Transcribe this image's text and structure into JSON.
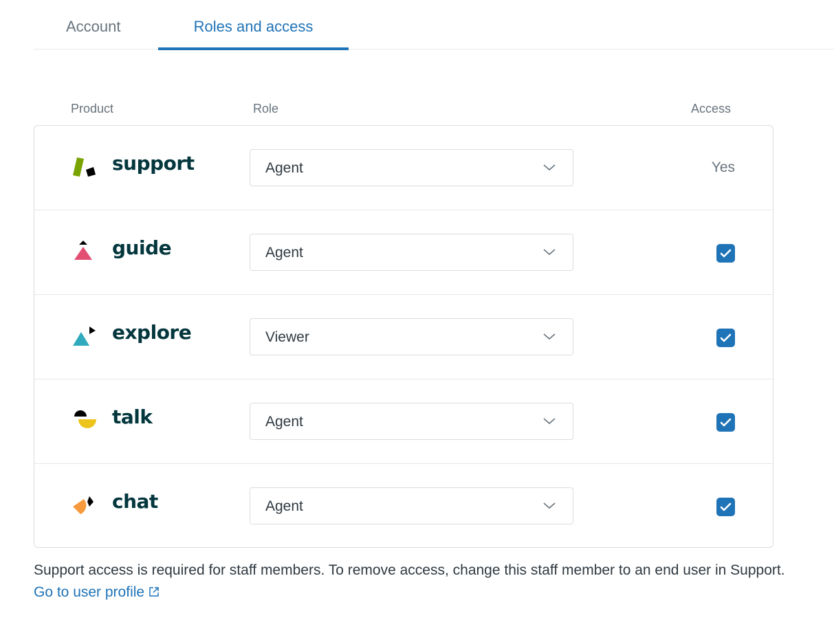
{
  "tabs": [
    {
      "label": "Account",
      "active": false
    },
    {
      "label": "Roles and access",
      "active": true
    }
  ],
  "colors": {
    "accent": "#1f73b7",
    "brand_text": "#03363d"
  },
  "table": {
    "headers": {
      "product": "Product",
      "role": "Role",
      "access": "Access"
    },
    "rows": [
      {
        "product": "support",
        "icon": "support-logo-icon",
        "role": "Agent",
        "access_type": "text",
        "access_text": "Yes",
        "checked": null
      },
      {
        "product": "guide",
        "icon": "guide-logo-icon",
        "role": "Agent",
        "access_type": "checkbox",
        "access_text": null,
        "checked": true
      },
      {
        "product": "explore",
        "icon": "explore-logo-icon",
        "role": "Viewer",
        "access_type": "checkbox",
        "access_text": null,
        "checked": true
      },
      {
        "product": "talk",
        "icon": "talk-logo-icon",
        "role": "Agent",
        "access_type": "checkbox",
        "access_text": null,
        "checked": true
      },
      {
        "product": "chat",
        "icon": "chat-logo-icon",
        "role": "Agent",
        "access_type": "checkbox",
        "access_text": null,
        "checked": true
      }
    ]
  },
  "note": {
    "text": "Support access is required for staff members. To remove access, change this staff member to an end user in Support.",
    "link_label": "Go to user profile",
    "link_icon": "external-link-icon"
  }
}
